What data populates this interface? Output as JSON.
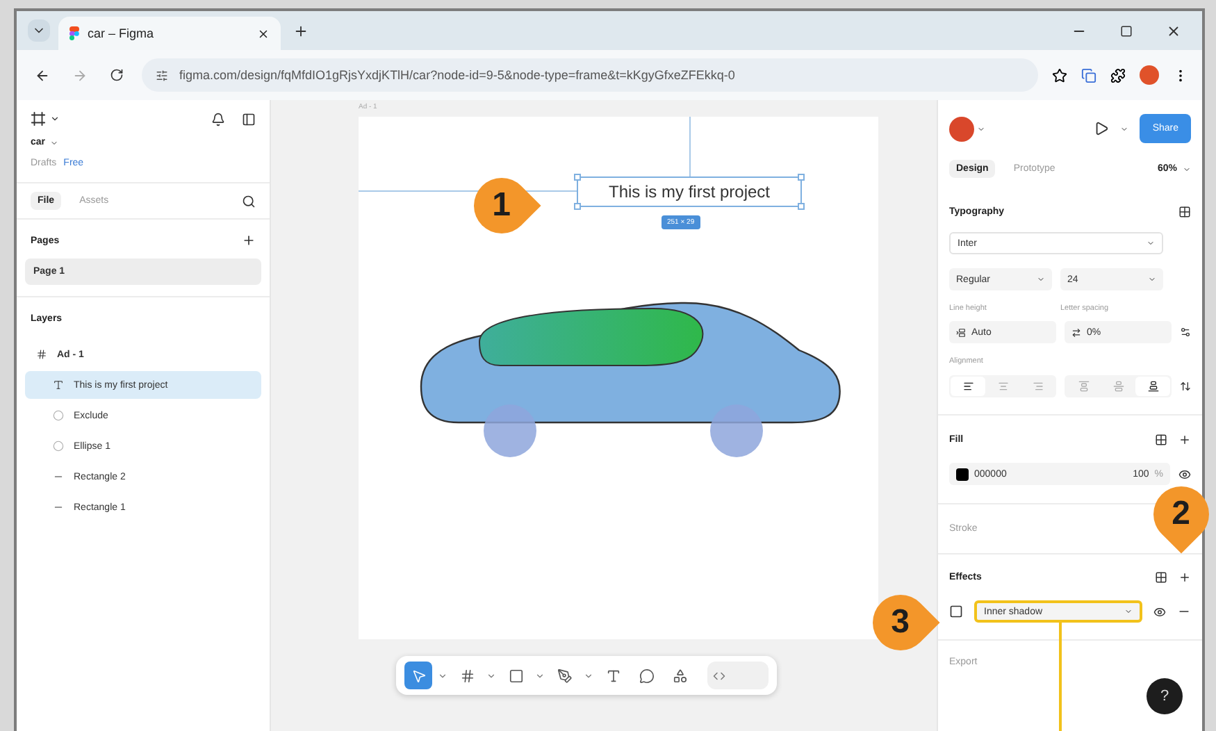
{
  "browser": {
    "tab_title": "car – Figma",
    "url": "figma.com/design/fqMfdIO1gRjsYxdjKTlH/car?node-id=9-5&node-type=frame&t=kKgyGfxeZFEkkq-0"
  },
  "left_panel": {
    "file_name": "car",
    "location": "Drafts",
    "plan": "Free",
    "tabs": [
      {
        "label": "File",
        "selected": true
      },
      {
        "label": "Assets",
        "selected": false
      }
    ],
    "pages_title": "Pages",
    "pages": [
      {
        "name": "Page 1",
        "selected": true
      }
    ],
    "layers_title": "Layers",
    "layers": [
      {
        "name": "Ad - 1",
        "kind": "frame",
        "selected": false,
        "children": [
          {
            "name": "This is my first project",
            "kind": "text",
            "selected": true
          },
          {
            "name": "Exclude",
            "kind": "boolean",
            "selected": false
          },
          {
            "name": "Ellipse 1",
            "kind": "ellipse",
            "selected": false
          },
          {
            "name": "Rectangle 2",
            "kind": "rect",
            "selected": false
          },
          {
            "name": "Rectangle 1",
            "kind": "rect",
            "selected": false
          }
        ]
      }
    ]
  },
  "canvas": {
    "frame_label": "Ad - 1",
    "heading": "This is my first project",
    "size_badge": "251 × 29",
    "tools": [
      {
        "kind": "move",
        "selected": true,
        "menu": true
      },
      {
        "kind": "frame",
        "selected": false,
        "menu": true
      },
      {
        "kind": "shape",
        "selected": false,
        "menu": true
      },
      {
        "kind": "pen",
        "selected": false,
        "menu": true
      },
      {
        "kind": "text",
        "selected": false,
        "menu": false
      },
      {
        "kind": "comment",
        "selected": false,
        "menu": false
      },
      {
        "kind": "actions",
        "selected": false,
        "menu": false
      }
    ],
    "dev_mode": false
  },
  "right_panel": {
    "share": "Share",
    "tabs": [
      {
        "label": "Design",
        "selected": true
      },
      {
        "label": "Prototype",
        "selected": false
      }
    ],
    "zoom": "60%",
    "typography": {
      "title": "Typography",
      "font": "Inter",
      "weight": "Regular",
      "size": "24",
      "line_height_label": "Line height",
      "line_height": "Auto",
      "letter_spacing_label": "Letter spacing",
      "letter_spacing": "0%",
      "alignment_label": "Alignment",
      "horizontal": [
        {
          "kind": "left",
          "selected": true
        },
        {
          "kind": "center",
          "selected": false
        },
        {
          "kind": "right",
          "selected": false
        }
      ],
      "vertical": [
        {
          "kind": "top",
          "selected": false
        },
        {
          "kind": "middle",
          "selected": false
        },
        {
          "kind": "bottom",
          "selected": true
        }
      ]
    },
    "fill": {
      "title": "Fill",
      "hex": "000000",
      "opacity": "100",
      "unit": "%"
    },
    "stroke": {
      "title": "Stroke"
    },
    "effects": {
      "title": "Effects",
      "items": [
        {
          "type": "Inner shadow",
          "highlighted": true
        }
      ]
    },
    "export": {
      "title": "Export"
    },
    "help": "?"
  },
  "callouts": [
    {
      "number": "1"
    },
    {
      "number": "2"
    },
    {
      "number": "3"
    }
  ]
}
